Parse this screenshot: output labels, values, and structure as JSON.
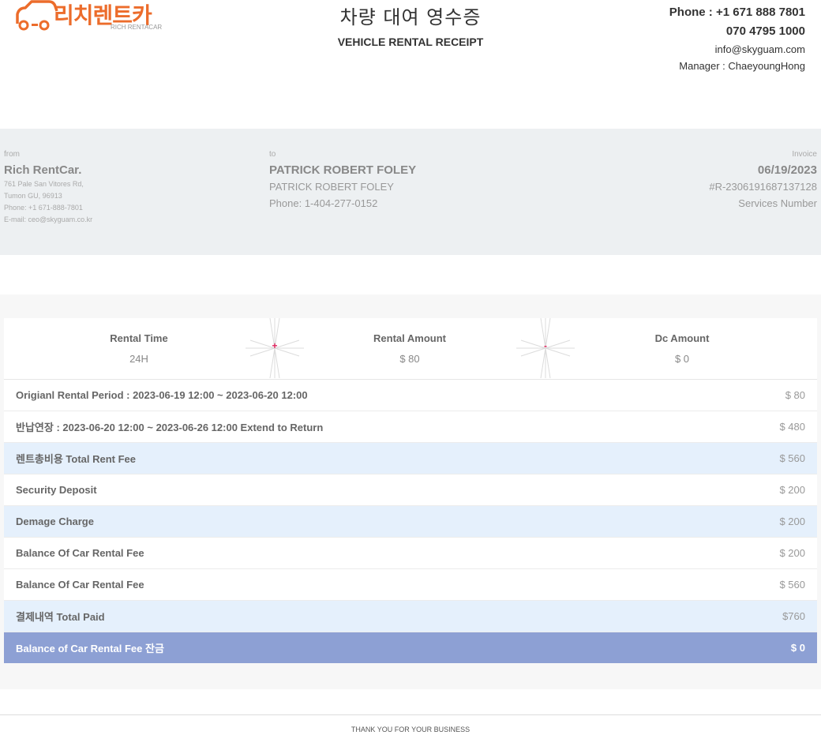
{
  "header": {
    "logo": {
      "brand_ko": "리치렌트카",
      "brand_en": "RICH RENTACAR"
    },
    "title_ko": "차량 대여 영수증",
    "title_en": "VEHICLE RENTAL RECEIPT",
    "phone": "Phone : +1 671 888 7801",
    "phone2": "070 4795 1000",
    "email": "info@skyguam.com",
    "manager": "Manager : ChaeyoungHong"
  },
  "from": {
    "label": "from",
    "name": "Rich RentCar.",
    "address1": "761 Pale San Vitores Rd,",
    "address2": "Tumon GU, 96913",
    "phone": "Phone: +1 671-888-7801",
    "email": "E-mail: ceo@skyguam.co.kr"
  },
  "to": {
    "label": "to",
    "name": "PATRICK ROBERT FOLEY",
    "name2": "PATRICK ROBERT FOLEY",
    "phone": "Phone: 1-404-277-0152"
  },
  "invoice": {
    "label": "Invoice",
    "date": "06/19/2023",
    "number": "#R-2306191687137128",
    "caption": "Services Number"
  },
  "summary": {
    "rental_time_label": "Rental Time",
    "rental_time_value": "24",
    "rental_time_unit": "H",
    "plus": "+",
    "rental_amount_label": "Rental Amount",
    "rental_amount_value": "$ 80",
    "minus": "-",
    "dc_amount_label": "Dc Amount",
    "dc_amount_value": "$ 0",
    "accent_color": "#e0245e"
  },
  "rows": [
    {
      "label": "Origianl Rental Period : 2023-06-19 12:00 ~ 2023-06-20 12:00",
      "amount": "$ 80"
    },
    {
      "label": "반납연장 : 2023-06-20 12:00 ~ 2023-06-26 12:00 Extend to Return",
      "amount": "$ 480"
    },
    {
      "label": "렌트총비용 Total Rent Fee",
      "amount": "$ 560"
    },
    {
      "label": "Security Deposit",
      "amount": "$ 200"
    },
    {
      "label": "Demage Charge",
      "amount": "$ 200"
    },
    {
      "label": "Balance Of Car Rental Fee",
      "amount": "$ 200"
    },
    {
      "label": "Balance Of Car Rental Fee",
      "amount": "$ 560"
    },
    {
      "label": "결제내역 Total Paid",
      "amount": "$760"
    },
    {
      "label": "Balance of Car Rental Fee 잔금",
      "amount": "$ 0"
    }
  ],
  "colors": {
    "highlight_row": "#e5f0fc",
    "final_row": "#8da0d4",
    "logo_orange": "#ec6c2b"
  },
  "footer": "THANK YOU FOR YOUR BUSINESS"
}
